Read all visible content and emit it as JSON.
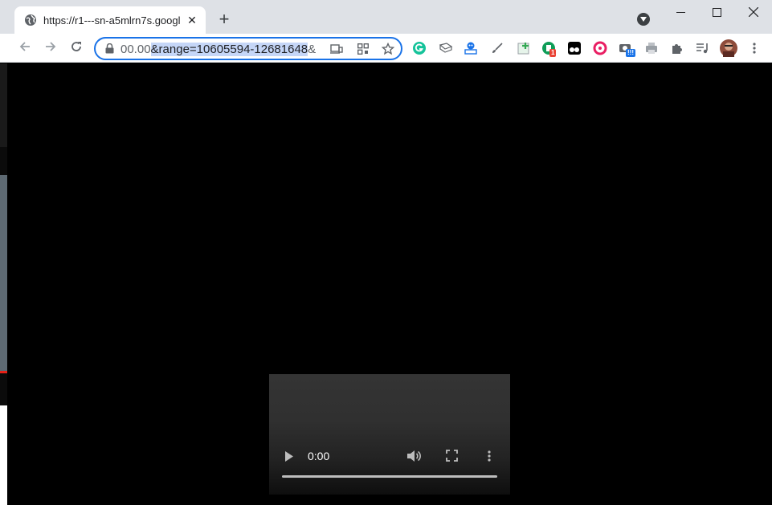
{
  "tab": {
    "title": "https://r1---sn-a5mlrn7s.googl",
    "close": "✕",
    "favicon": "globe-icon"
  },
  "newtab": {
    "label": "+"
  },
  "omnibox": {
    "url_plain": "00.00",
    "url_selected": "&range=10605594-12681648",
    "url_tail": "&"
  },
  "video": {
    "time": "0:00"
  },
  "extensions": [
    {
      "name": "grammarly-icon",
      "color": "#15c39a"
    },
    {
      "name": "ext-book-icon",
      "color": "#5f6368"
    },
    {
      "name": "ext-robot-icon",
      "color": "#1a73e8"
    },
    {
      "name": "ext-brush-icon",
      "color": "#5f6368"
    },
    {
      "name": "ext-plus-icon",
      "color": "#34a853",
      "badge": ""
    },
    {
      "name": "ext-green-icon",
      "color": "#0f9d58",
      "badge": "1"
    },
    {
      "name": "tampermonkey-icon",
      "color": "#000000"
    },
    {
      "name": "ext-ring-icon",
      "color": "#e91e63"
    },
    {
      "name": "ext-camera-icon",
      "color": "#5f6368",
      "badge": "!!!"
    },
    {
      "name": "ext-printer-icon",
      "color": "#9aa0a6"
    }
  ],
  "colors": {
    "accent": "#1a73e8",
    "badge_red": "#ea4335",
    "badge_blue": "#1a73e8"
  }
}
